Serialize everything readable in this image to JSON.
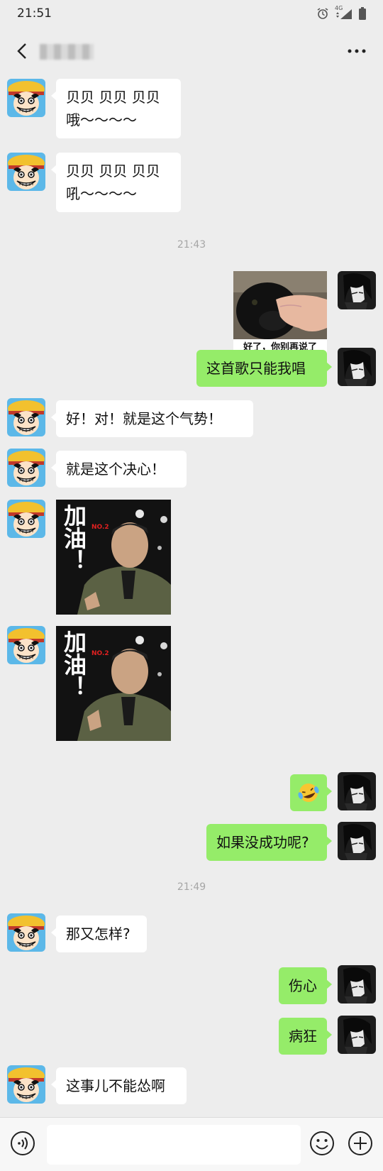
{
  "status_bar": {
    "time": "21:51",
    "network": "4G"
  },
  "header": {
    "contact_name": "██████"
  },
  "messages": {
    "m1": "贝贝 贝贝 贝贝\n哦～～～～",
    "m2": "贝贝 贝贝 贝贝\n吼～～～～",
    "time1": "21:43",
    "sticker_dog_caption": "好了，你别再说了",
    "m3": "这首歌只能我唱",
    "m4": "好！对！就是这个气势！",
    "m5": "就是这个决心！",
    "sticker_jiayou_text": "加油！",
    "sticker_jiayou_badge": "NO.2",
    "m6_emoji": "🤣",
    "m7": "如果没成功呢?",
    "time2": "21:49",
    "m8": "那又怎样?",
    "m9": "伤心",
    "m10": "病狂",
    "m11": "这事儿不能怂啊"
  },
  "colors": {
    "sent_bubble": "#95ec69",
    "received_bubble": "#ffffff",
    "background": "#ededed"
  },
  "icons": {
    "back": "chevron-left-icon",
    "more": "more-dots-icon",
    "voice": "voice-icon",
    "emoji": "emoji-icon",
    "plus": "plus-icon"
  }
}
